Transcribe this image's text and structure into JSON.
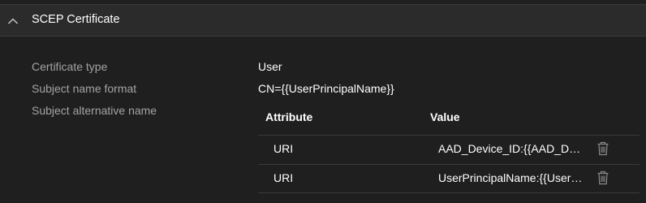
{
  "section": {
    "title": "SCEP Certificate",
    "expanded": true
  },
  "properties": [
    {
      "label": "Certificate type",
      "value": "User"
    },
    {
      "label": "Subject name format",
      "value": "CN={{UserPrincipalName}}"
    },
    {
      "label": "Subject alternative name",
      "value": ""
    }
  ],
  "san_table": {
    "columns": [
      "Attribute",
      "Value"
    ],
    "rows": [
      {
        "attribute": "URI",
        "value": "AAD_Device_ID:{{AAD_Device_ID}}",
        "delete_icon": "trash-icon"
      },
      {
        "attribute": "URI",
        "value": "UserPrincipalName:{{UserPrincipalName}}",
        "delete_icon": "trash-icon"
      }
    ]
  },
  "colors": {
    "background": "#1f1f1f",
    "header_background": "#2b2b2b",
    "label_text": "#a3a3a3",
    "value_text": "#ffffff",
    "icon": "#8a8a8a",
    "divider": "#3a3a3a"
  },
  "icons": {
    "section_toggle": "chevron-up-icon",
    "row_delete": "trash-icon"
  }
}
